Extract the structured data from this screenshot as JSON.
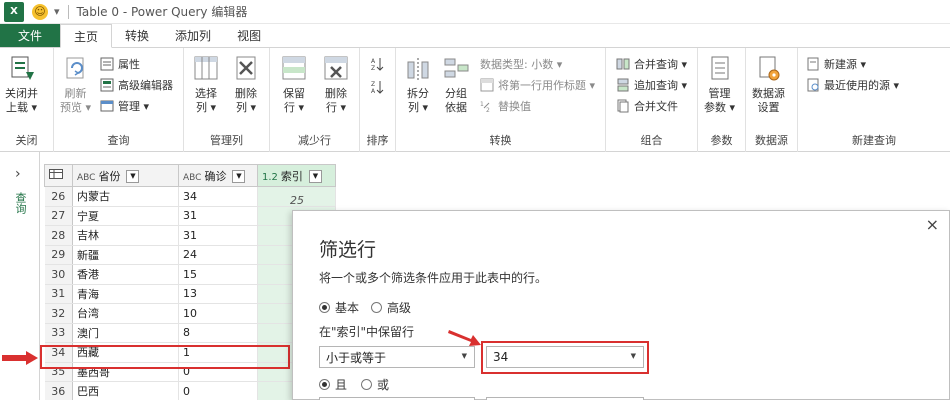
{
  "titlebar": {
    "app_logo": "X",
    "qa_dropdown": "▾",
    "title": "Table 0 - Power Query 编辑器"
  },
  "tabs": [
    {
      "label": "文件",
      "kind": "file"
    },
    {
      "label": "主页",
      "kind": "active"
    },
    {
      "label": "转换",
      "kind": "normal"
    },
    {
      "label": "添加列",
      "kind": "normal"
    },
    {
      "label": "视图",
      "kind": "normal"
    }
  ],
  "ribbon": {
    "close_group": {
      "label": "关闭",
      "close_load": "关闭并\n上载 ▾"
    },
    "query_group": {
      "label": "查询",
      "refresh": "刷新\n预览 ▾",
      "properties": "属性",
      "advanced_editor": "高级编辑器",
      "manage": "管理 ▾"
    },
    "manage_cols_group": {
      "label": "管理列",
      "choose_cols": "选择\n列 ▾",
      "remove_cols": "删除\n列 ▾"
    },
    "reduce_rows_group": {
      "label": "减少行",
      "keep_rows": "保留\n行 ▾",
      "remove_rows": "删除\n行 ▾"
    },
    "sort_group": {
      "label": "排序"
    },
    "transform_group": {
      "label": "转换",
      "split_col": "拆分\n列 ▾",
      "group_by": "分组\n依据",
      "data_type": "数据类型: 小数 ▾",
      "first_row_header": "将第一行用作标题 ▾",
      "replace_values": "替换值"
    },
    "combine_group": {
      "label": "组合",
      "merge_queries": "合并查询 ▾",
      "append_queries": "追加查询 ▾",
      "merge_files": "合并文件"
    },
    "params_group": {
      "label": "参数",
      "manage_params": "管理\n参数 ▾"
    },
    "datasource_group": {
      "label": "数据源",
      "ds_settings": "数据源\n设置"
    },
    "newquery_group": {
      "label": "新建查询",
      "new_source": "新建源 ▾",
      "recent_sources": "最近使用的源 ▾"
    }
  },
  "leftpane": {
    "chevron": "›",
    "label": "查询"
  },
  "grid": {
    "headers": [
      {
        "type": "ABC",
        "label": "省份"
      },
      {
        "type": "ABC",
        "label": "确诊"
      },
      {
        "type": "1.2",
        "label": "索引"
      }
    ],
    "rows": [
      {
        "n": "26",
        "province": "内蒙古",
        "confirmed": "34"
      },
      {
        "n": "27",
        "province": "宁夏",
        "confirmed": "31"
      },
      {
        "n": "28",
        "province": "吉林",
        "confirmed": "31"
      },
      {
        "n": "29",
        "province": "新疆",
        "confirmed": "24"
      },
      {
        "n": "30",
        "province": "香港",
        "confirmed": "15"
      },
      {
        "n": "31",
        "province": "青海",
        "confirmed": "13"
      },
      {
        "n": "32",
        "province": "台湾",
        "confirmed": "10"
      },
      {
        "n": "33",
        "province": "澳门",
        "confirmed": "8"
      },
      {
        "n": "34",
        "province": "西藏",
        "confirmed": "1"
      },
      {
        "n": "35",
        "province": "墨西哥",
        "confirmed": "0"
      },
      {
        "n": "36",
        "province": "巴西",
        "confirmed": "0"
      }
    ],
    "index_value_shown": "25"
  },
  "dialog": {
    "close": "×",
    "title": "筛选行",
    "description": "将一个或多个筛选条件应用于此表中的行。",
    "mode_basic": "基本",
    "mode_advanced": "高级",
    "keep_label": "在\"索引\"中保留行",
    "operator": "小于或等于",
    "value": "34",
    "and_label": "且",
    "or_label": "或"
  },
  "colors": {
    "accent": "#217346",
    "highlight": "#d9302f",
    "selected_col": "#d6efdc"
  }
}
